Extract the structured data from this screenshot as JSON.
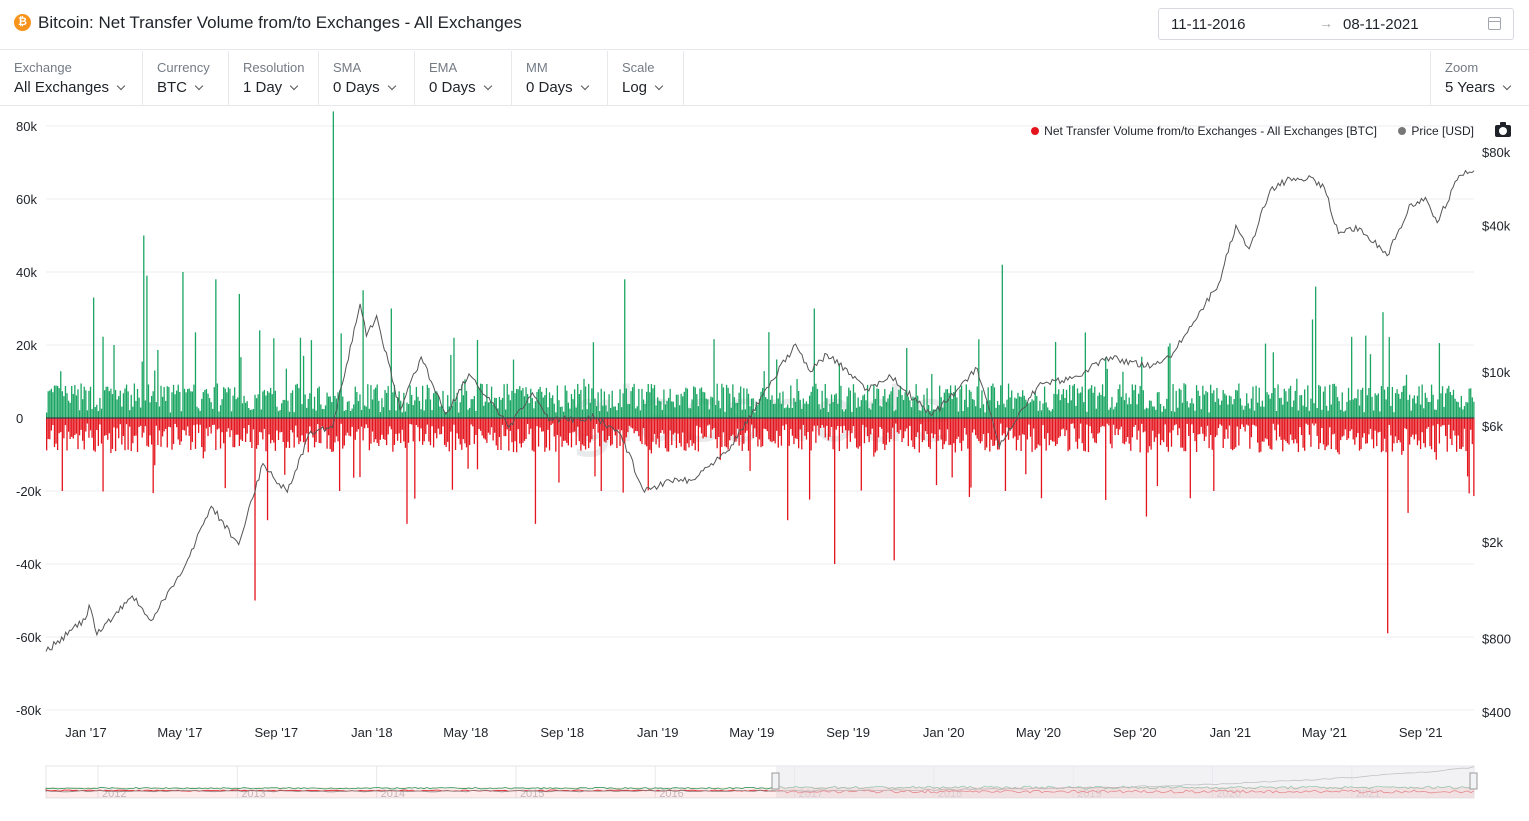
{
  "header": {
    "icon": "bitcoin-icon",
    "icon_glyph": "₿",
    "title": "Bitcoin: Net Transfer Volume from/to Exchanges - All Exchanges",
    "date_start": "11-11-2016",
    "date_arrow": "→",
    "date_end": "08-11-2021"
  },
  "controls": [
    {
      "label": "Exchange",
      "value": "All Exchanges"
    },
    {
      "label": "Currency",
      "value": "BTC"
    },
    {
      "label": "Resolution",
      "value": "1 Day"
    },
    {
      "label": "SMA",
      "value": "0 Days"
    },
    {
      "label": "EMA",
      "value": "0 Days"
    },
    {
      "label": "MM",
      "value": "0 Days"
    },
    {
      "label": "Scale",
      "value": "Log"
    }
  ],
  "zoom": {
    "label": "Zoom",
    "value": "5 Years"
  },
  "legend": {
    "series1": "Net Transfer Volume from/to Exchanges - All Exchanges [BTC]",
    "series2": "Price [USD]"
  },
  "watermark": "glassnode",
  "colors": {
    "inflow": "#1aa562",
    "outflow": "#e4141c",
    "price": "#555555",
    "legend_net": "#e4141c",
    "legend_price": "#777777",
    "grid": "#eceef0",
    "navigator_mask": "#e9eaec"
  },
  "chart_data": {
    "type": "bar",
    "x_range": [
      "2016-11-11",
      "2021-11-08"
    ],
    "x_tick_labels": [
      "Jan '17",
      "May '17",
      "Sep '17",
      "Jan '18",
      "May '18",
      "Sep '18",
      "Jan '19",
      "May '19",
      "Sep '19",
      "Jan '20",
      "May '20",
      "Sep '20",
      "Jan '21",
      "May '21",
      "Sep '21"
    ],
    "y_left": {
      "ticks": [
        80000,
        60000,
        40000,
        20000,
        0,
        -20000,
        -40000,
        -60000,
        -80000
      ],
      "tick_labels": [
        "80k",
        "60k",
        "40k",
        "20k",
        "0",
        "-20k",
        "-40k",
        "-60k",
        "-80k"
      ],
      "range": [
        -80000,
        80000
      ]
    },
    "y_right": {
      "scale": "log",
      "ticks": [
        80000,
        40000,
        10000,
        6000,
        2000,
        800,
        400
      ],
      "tick_labels": [
        "$80k",
        "$40k",
        "$10k",
        "$6k",
        "$2k",
        "$800",
        "$400"
      ],
      "range": [
        400,
        80000
      ]
    },
    "series": [
      {
        "name": "Net Transfer Volume from/to Exchanges - All Exchanges [BTC]",
        "axis": "left",
        "typical_inflow": 5000,
        "typical_outflow": -5000,
        "peaks": [
          {
            "date": "2016-12-01",
            "value": -20000
          },
          {
            "date": "2017-01-10",
            "value": 33000
          },
          {
            "date": "2017-02-05",
            "value": 20000
          },
          {
            "date": "2017-03-15",
            "value": 50000
          },
          {
            "date": "2017-03-20",
            "value": 39000
          },
          {
            "date": "2017-05-05",
            "value": 40000
          },
          {
            "date": "2017-06-15",
            "value": 38000
          },
          {
            "date": "2017-07-15",
            "value": 34000
          },
          {
            "date": "2017-08-05",
            "value": -50000
          },
          {
            "date": "2017-08-20",
            "value": -28000
          },
          {
            "date": "2017-10-01",
            "value": 22000
          },
          {
            "date": "2017-11-12",
            "value": 84000
          },
          {
            "date": "2017-11-20",
            "value": -20000
          },
          {
            "date": "2017-12-20",
            "value": 35000
          },
          {
            "date": "2018-01-25",
            "value": 30000
          },
          {
            "date": "2018-02-15",
            "value": -29000
          },
          {
            "date": "2018-04-15",
            "value": 22000
          },
          {
            "date": "2018-07-01",
            "value": 16000
          },
          {
            "date": "2018-07-29",
            "value": -29000
          },
          {
            "date": "2018-10-20",
            "value": -20000
          },
          {
            "date": "2018-11-20",
            "value": 38000
          },
          {
            "date": "2019-06-15",
            "value": -28000
          },
          {
            "date": "2019-07-20",
            "value": 30000
          },
          {
            "date": "2019-08-15",
            "value": -40000
          },
          {
            "date": "2019-10-30",
            "value": -39000
          },
          {
            "date": "2020-03-15",
            "value": 42000
          },
          {
            "date": "2020-03-20",
            "value": -20000
          },
          {
            "date": "2020-05-05",
            "value": -22000
          },
          {
            "date": "2020-09-15",
            "value": -27000
          },
          {
            "date": "2020-12-10",
            "value": -20000
          },
          {
            "date": "2021-02-25",
            "value": 18000
          },
          {
            "date": "2021-04-15",
            "value": 27000
          },
          {
            "date": "2021-04-20",
            "value": 36000
          },
          {
            "date": "2021-07-15",
            "value": 29000
          },
          {
            "date": "2021-07-20",
            "value": -59000
          },
          {
            "date": "2021-08-15",
            "value": -26000
          },
          {
            "date": "2021-10-30",
            "value": -16000
          }
        ]
      },
      {
        "name": "Price [USD]",
        "axis": "right",
        "points": [
          {
            "date": "2016-11-11",
            "value": 710
          },
          {
            "date": "2016-12-31",
            "value": 960
          },
          {
            "date": "2017-01-05",
            "value": 1100
          },
          {
            "date": "2017-01-15",
            "value": 830
          },
          {
            "date": "2017-03-01",
            "value": 1200
          },
          {
            "date": "2017-03-25",
            "value": 950
          },
          {
            "date": "2017-05-01",
            "value": 1450
          },
          {
            "date": "2017-06-10",
            "value": 2800
          },
          {
            "date": "2017-07-15",
            "value": 1950
          },
          {
            "date": "2017-08-15",
            "value": 4200
          },
          {
            "date": "2017-09-15",
            "value": 3200
          },
          {
            "date": "2017-10-15",
            "value": 5700
          },
          {
            "date": "2017-11-12",
            "value": 5900
          },
          {
            "date": "2017-12-17",
            "value": 19000
          },
          {
            "date": "2017-12-25",
            "value": 14000
          },
          {
            "date": "2018-01-07",
            "value": 17000
          },
          {
            "date": "2018-02-06",
            "value": 7000
          },
          {
            "date": "2018-03-05",
            "value": 11500
          },
          {
            "date": "2018-04-05",
            "value": 6700
          },
          {
            "date": "2018-05-05",
            "value": 9800
          },
          {
            "date": "2018-06-25",
            "value": 5900
          },
          {
            "date": "2018-07-25",
            "value": 8200
          },
          {
            "date": "2018-08-15",
            "value": 6300
          },
          {
            "date": "2018-10-15",
            "value": 6500
          },
          {
            "date": "2018-11-15",
            "value": 5500
          },
          {
            "date": "2018-12-15",
            "value": 3200
          },
          {
            "date": "2019-01-15",
            "value": 3600
          },
          {
            "date": "2019-02-15",
            "value": 3600
          },
          {
            "date": "2019-04-05",
            "value": 5000
          },
          {
            "date": "2019-05-15",
            "value": 8000
          },
          {
            "date": "2019-06-26",
            "value": 13000
          },
          {
            "date": "2019-07-15",
            "value": 10000
          },
          {
            "date": "2019-08-05",
            "value": 11800
          },
          {
            "date": "2019-09-25",
            "value": 8500
          },
          {
            "date": "2019-10-26",
            "value": 9500
          },
          {
            "date": "2019-12-17",
            "value": 6600
          },
          {
            "date": "2020-02-13",
            "value": 10300
          },
          {
            "date": "2020-03-12",
            "value": 4900
          },
          {
            "date": "2020-05-01",
            "value": 8800
          },
          {
            "date": "2020-06-15",
            "value": 9500
          },
          {
            "date": "2020-08-01",
            "value": 11500
          },
          {
            "date": "2020-09-15",
            "value": 10500
          },
          {
            "date": "2020-10-15",
            "value": 11500
          },
          {
            "date": "2020-11-15",
            "value": 16000
          },
          {
            "date": "2020-12-17",
            "value": 23000
          },
          {
            "date": "2021-01-08",
            "value": 40000
          },
          {
            "date": "2021-01-25",
            "value": 32000
          },
          {
            "date": "2021-02-21",
            "value": 56000
          },
          {
            "date": "2021-03-13",
            "value": 61000
          },
          {
            "date": "2021-04-14",
            "value": 63000
          },
          {
            "date": "2021-05-01",
            "value": 57000
          },
          {
            "date": "2021-05-19",
            "value": 37000
          },
          {
            "date": "2021-06-15",
            "value": 39000
          },
          {
            "date": "2021-07-20",
            "value": 30000
          },
          {
            "date": "2021-08-20",
            "value": 49000
          },
          {
            "date": "2021-09-07",
            "value": 52000
          },
          {
            "date": "2021-09-22",
            "value": 41000
          },
          {
            "date": "2021-10-20",
            "value": 64000
          },
          {
            "date": "2021-11-08",
            "value": 67000
          }
        ]
      }
    ],
    "navigator_year_labels": [
      "2012",
      "2013",
      "2014",
      "2015",
      "2016",
      "2017",
      "2018",
      "2019",
      "2020",
      "2021"
    ],
    "grid": true,
    "legend_position": "top-right"
  }
}
